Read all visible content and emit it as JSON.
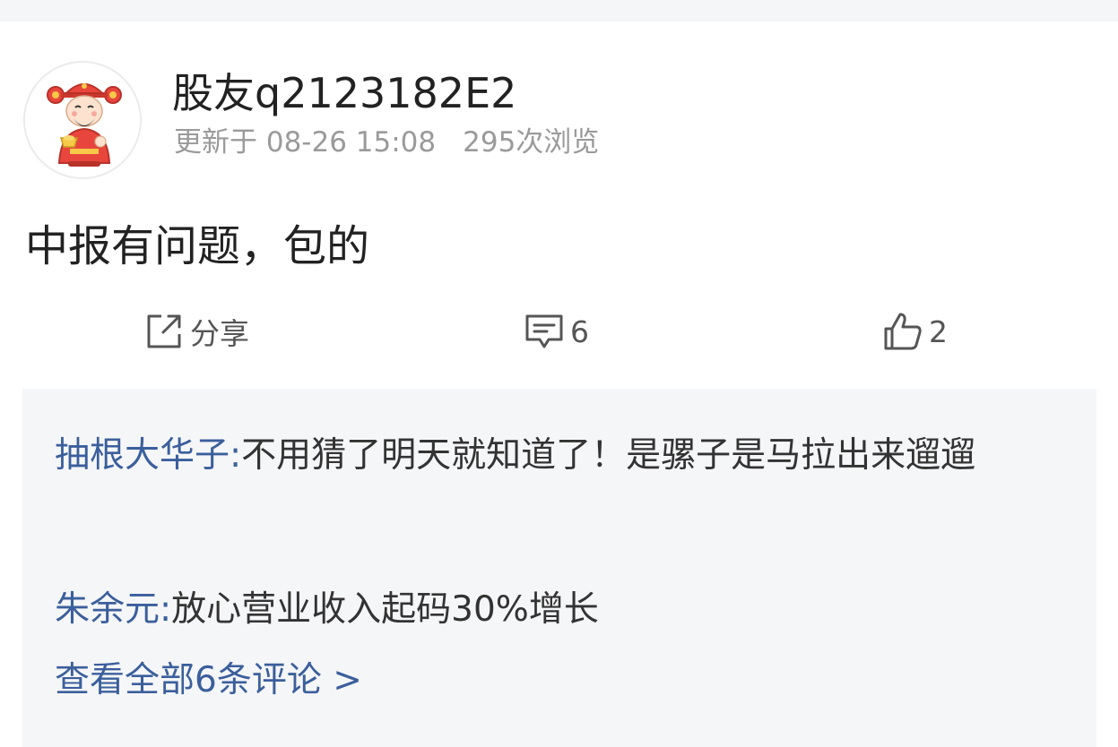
{
  "header": {
    "username": "股友q2123182E2",
    "updated": "更新于 08-26 15:08",
    "views": "295次浏览"
  },
  "post": {
    "content": "中报有问题，包的"
  },
  "actions": {
    "share_label": "分享",
    "comment_count": "6",
    "like_count": "2"
  },
  "comments": {
    "items": [
      {
        "author": "抽根大华子:",
        "text": "不用猜了明天就知道了！是骡子是马拉出来遛遛"
      },
      {
        "author": "朱余元:",
        "text": "放心营业收入起码30%增长"
      }
    ],
    "view_all": "查看全部6条评论 >"
  },
  "colors": {
    "link_blue": "#3b5f9c",
    "meta_gray": "#9a9a9a",
    "panel_bg": "#f5f6f8"
  },
  "icons": [
    "avatar-god-of-wealth",
    "share-icon",
    "comment-icon",
    "thumbs-up-icon"
  ]
}
